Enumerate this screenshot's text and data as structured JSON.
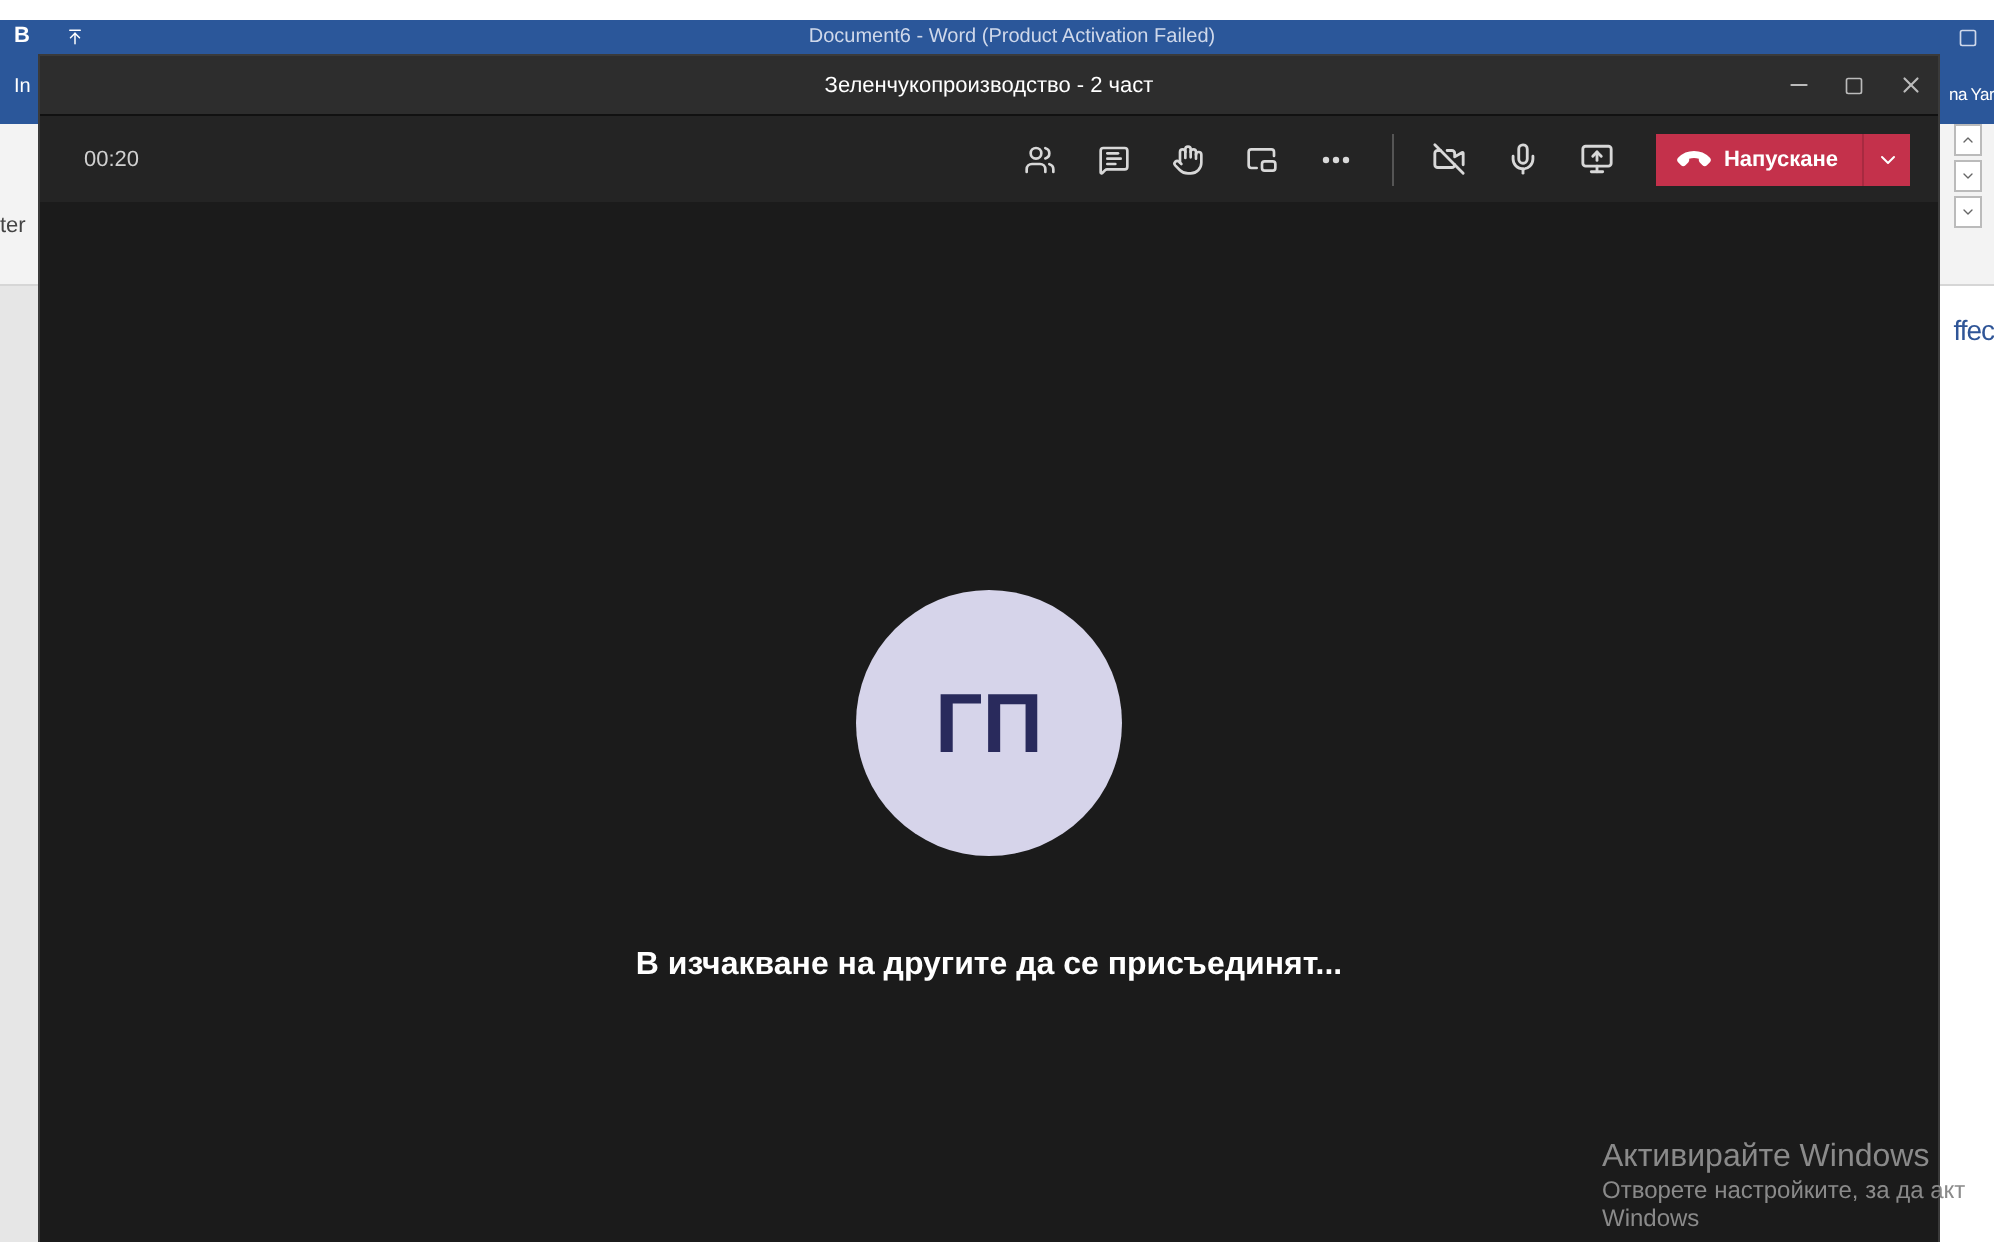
{
  "word_window": {
    "quick_access": "B",
    "title": "Document6 - Word (Product Activation Failed)",
    "left_fragments": [
      "In",
      "ter"
    ],
    "right_fragments": [
      "na Yar",
      "ffec"
    ]
  },
  "meeting_window": {
    "title": "Зеленчукопроизводство - 2 част",
    "timer": "00:20",
    "toolbar": [
      {
        "kind": "people"
      },
      {
        "kind": "chat"
      },
      {
        "kind": "raise-hand"
      },
      {
        "kind": "rooms"
      },
      {
        "kind": "more"
      },
      {
        "kind": "divider"
      },
      {
        "kind": "camera",
        "on": false
      },
      {
        "kind": "microphone",
        "muted": false
      },
      {
        "kind": "share"
      }
    ],
    "leave_button": {
      "label": "Напускане"
    },
    "participant": {
      "initials": "ГП"
    },
    "status": "В изчакване на другите да се присъединят..."
  },
  "activation_notice": {
    "title": "Активирайте Windows",
    "line_1": "Отворете настройките, за да акт",
    "line_2": "Windows"
  }
}
